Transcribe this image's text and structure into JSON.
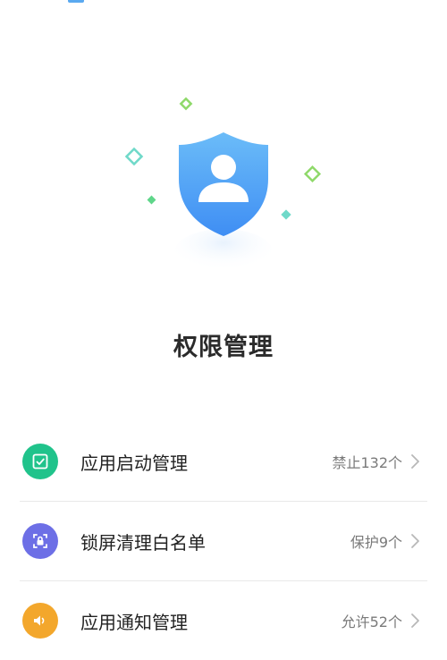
{
  "page": {
    "title": "权限管理"
  },
  "colors": {
    "shield_top": "#66b8f7",
    "shield_bottom": "#3f8ef4",
    "diamond_green": "#5fd68a",
    "diamond_teal": "#6fd9c9",
    "icon_green": "#20c38b",
    "icon_purple": "#6d6fe6",
    "icon_orange": "#f3a72c"
  },
  "items": [
    {
      "label": "应用启动管理",
      "value": "禁止132个",
      "icon": "checkbox-icon"
    },
    {
      "label": "锁屏清理白名单",
      "value": "保护9个",
      "icon": "lock-clean-icon"
    },
    {
      "label": "应用通知管理",
      "value": "允许52个",
      "icon": "sound-icon"
    }
  ]
}
